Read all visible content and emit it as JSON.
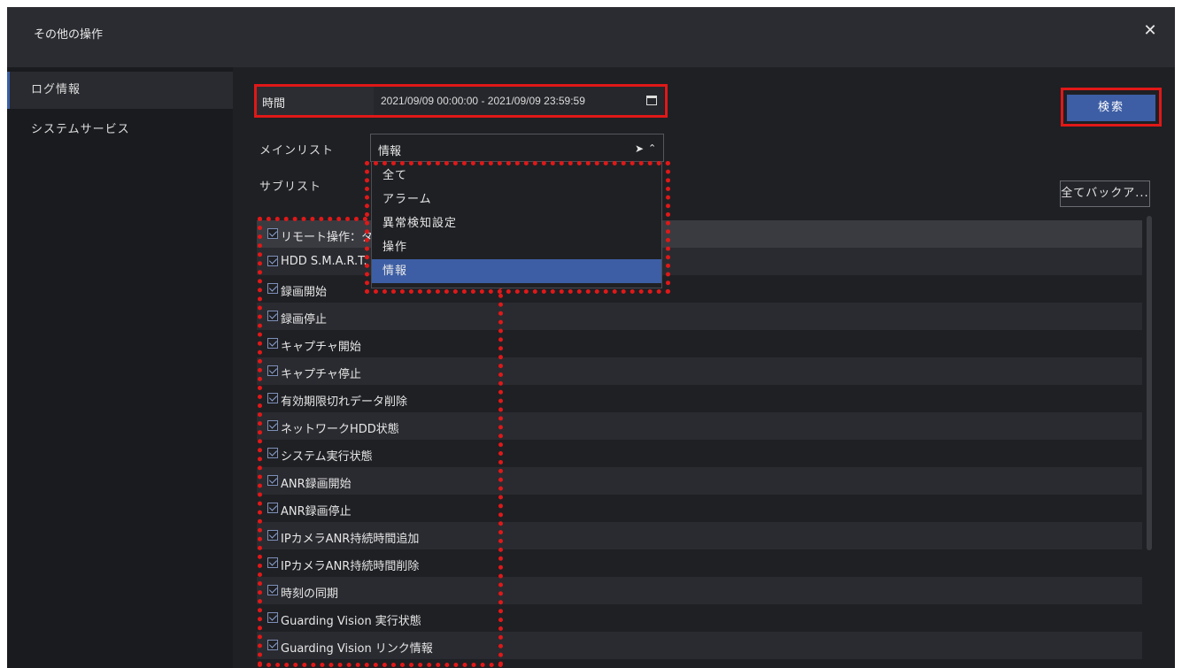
{
  "window": {
    "title": "その他の操作",
    "close_icon": "close-icon"
  },
  "sidebar": {
    "items": [
      {
        "label": "ログ情報",
        "active": true
      },
      {
        "label": "システムサービス",
        "active": false
      }
    ]
  },
  "form": {
    "time_label": "時間",
    "time_value": "2021/09/09 00:00:00 - 2021/09/09 23:59:59",
    "main_list_label": "メインリスト",
    "main_list_value": "情報",
    "sub_list_label": "サブリスト"
  },
  "buttons": {
    "search": "検索",
    "backup_all": "全てバックア..."
  },
  "dropdown": {
    "options": [
      "全て",
      "アラーム",
      "異常検知設定",
      "操作",
      "情報"
    ],
    "selected": "情報"
  },
  "list": {
    "items": [
      "リモート操作：タ",
      "HDD S.M.A.R.T.",
      "録画開始",
      "録画停止",
      "キャプチャ開始",
      "キャプチャ停止",
      "有効期限切れデータ削除",
      "ネットワークHDD状態",
      "システム実行状態",
      "ANR録画開始",
      "ANR録画停止",
      "IPカメラANR持続時間追加",
      "IPカメラANR持続時間削除",
      "時刻の同期",
      "Guarding Vision 実行状態",
      "Guarding Vision リンク情報"
    ],
    "all_checked": true
  },
  "colors": {
    "accent": "#3d5ea5",
    "highlight": "#e01818",
    "background": "#1f2024"
  }
}
